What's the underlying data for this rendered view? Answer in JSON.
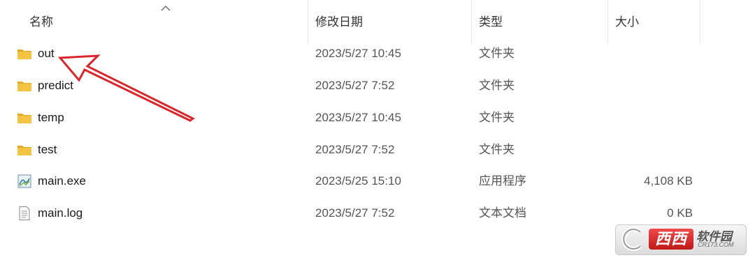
{
  "columns": {
    "name": "名称",
    "date": "修改日期",
    "type": "类型",
    "size": "大小"
  },
  "files": [
    {
      "name": "out",
      "date": "2023/5/27 10:45",
      "type": "文件夹",
      "size": "",
      "icon": "folder-icon"
    },
    {
      "name": "predict",
      "date": "2023/5/27 7:52",
      "type": "文件夹",
      "size": "",
      "icon": "folder-icon"
    },
    {
      "name": "temp",
      "date": "2023/5/27 10:45",
      "type": "文件夹",
      "size": "",
      "icon": "folder-icon"
    },
    {
      "name": "test",
      "date": "2023/5/27 7:52",
      "type": "文件夹",
      "size": "",
      "icon": "folder-icon"
    },
    {
      "name": "main.exe",
      "date": "2023/5/25 15:10",
      "type": "应用程序",
      "size": "4,108 KB",
      "icon": "exe-icon"
    },
    {
      "name": "main.log",
      "date": "2023/5/27 7:52",
      "type": "文本文档",
      "size": "0 KB",
      "icon": "text-file-icon"
    }
  ],
  "watermark": {
    "brand": "西西",
    "name": "软件园",
    "url": "CR173.COM"
  },
  "colors": {
    "folder": "#f5c342",
    "annotation_arrow": "#d9262c"
  }
}
